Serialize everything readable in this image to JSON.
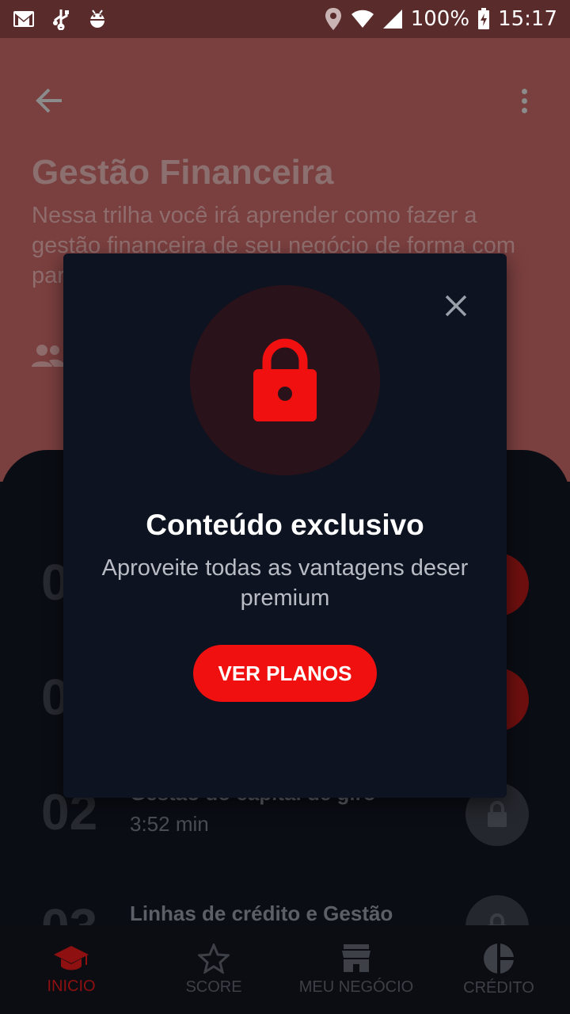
{
  "status_bar": {
    "battery": "100%",
    "time": "15:17"
  },
  "header": {
    "title": "Gestão Financeira",
    "description": "Nessa trilha você irá aprender como fazer a gestão financeira de seu negócio de forma com para"
  },
  "lessons": [
    {
      "num": "0",
      "title": "",
      "duration": "",
      "state": "play"
    },
    {
      "num": "0",
      "title": "",
      "duration": "",
      "state": "play"
    },
    {
      "num": "02",
      "title": "Gestão do capital de giro",
      "duration": "3:52 min",
      "state": "locked"
    },
    {
      "num": "03",
      "title": "Linhas de crédito e Gestão",
      "duration": "",
      "state": "locked"
    }
  ],
  "modal": {
    "title": "Conteúdo exclusivo",
    "subtitle": "Aproveite todas as vantagens deser premium",
    "button": "VER PLANOS"
  },
  "nav": [
    {
      "label": "INICIO",
      "icon": "graduation-cap-icon",
      "active": true
    },
    {
      "label": "SCORE",
      "icon": "star-icon",
      "active": false
    },
    {
      "label": "MEU NEGÓCIO",
      "icon": "store-icon",
      "active": false
    },
    {
      "label": "CRÉDITO",
      "icon": "pie-chart-icon",
      "active": false
    }
  ],
  "colors": {
    "accent": "#f01010",
    "modal_bg": "#0d1320",
    "header_bg": "#7a3f3f"
  }
}
